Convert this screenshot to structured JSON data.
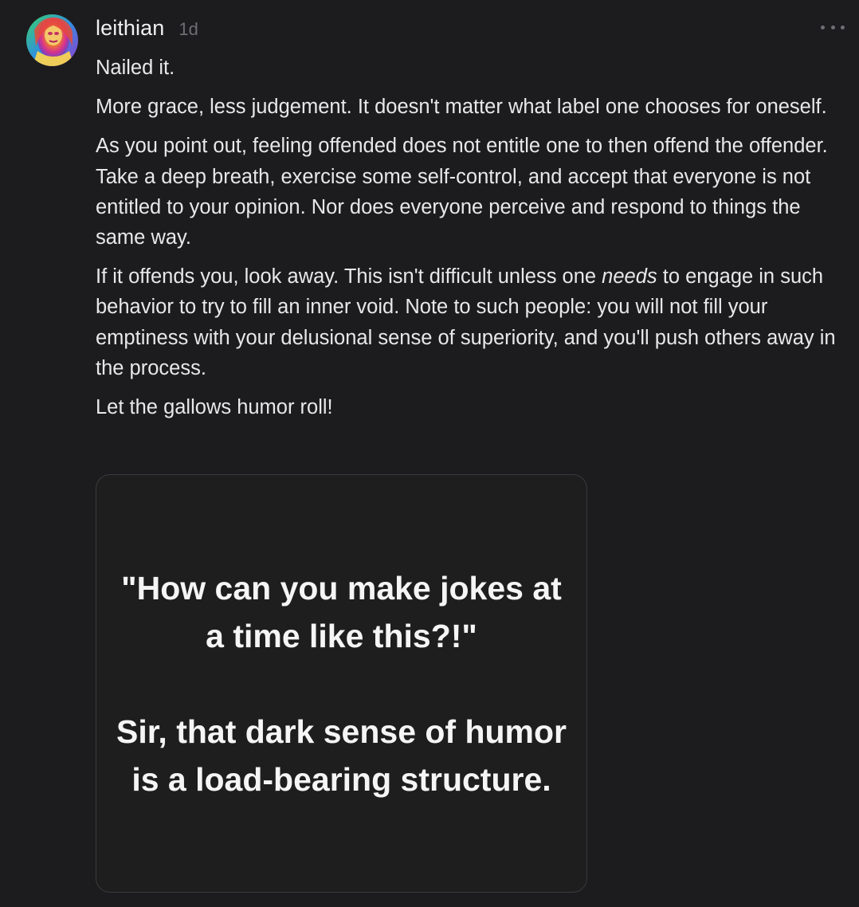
{
  "comment": {
    "username": "leithian",
    "timestamp": "1d",
    "more_icon": "more-horizontal-icon",
    "paragraphs": {
      "p1": "Nailed it.",
      "p2": "More grace, less judgement. It doesn't matter what label one chooses for oneself.",
      "p3": "As you point out, feeling offended does not entitle one to then offend the offender. Take a deep breath, exercise some self-control, and accept that everyone is not entitled to your opinion. Nor does everyone perceive and respond to things the same way.",
      "p4_before": "If it offends you, look away. This isn't difficult unless one ",
      "p4_em": "needs",
      "p4_after": " to engage in such behavior to try to fill an inner void. Note to such people: you will not fill your emptiness with your delusional sense of superiority, and you'll push others away in the process.",
      "p5": "Let the gallows humor roll!"
    },
    "image": {
      "line1": "\"How can you make jokes at",
      "line2": "a time like this?!\"",
      "line3": "Sir, that dark sense of humor",
      "line4": "is a load-bearing structure."
    }
  },
  "colors": {
    "background": "#1c1c1e",
    "text": "#e8e8ea",
    "muted": "#6e6e73"
  }
}
